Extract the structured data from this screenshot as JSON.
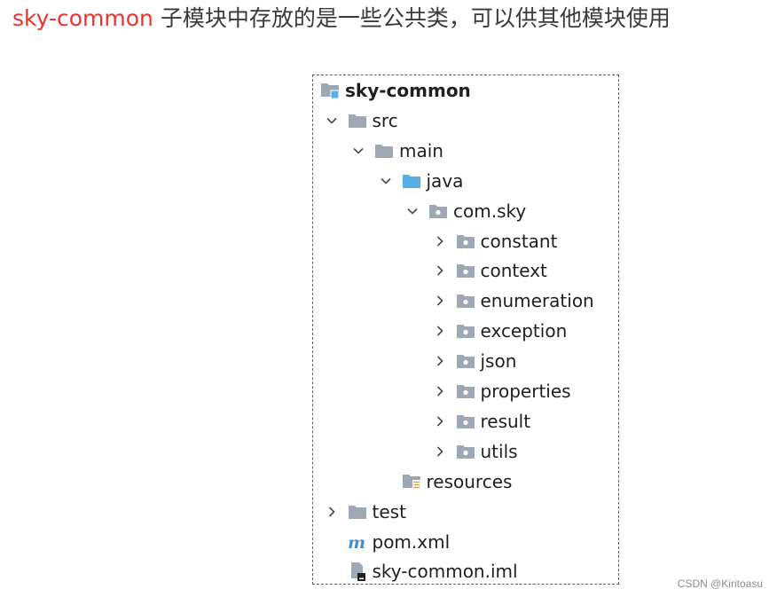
{
  "headline": {
    "accent": "sky-common",
    "rest": " 子模块中存放的是一些公共类，可以供其他模块使用"
  },
  "tree": {
    "items": [
      {
        "label": "sky-common",
        "level": 0,
        "icon": "module-folder-icon",
        "chevron": "none",
        "bold": true
      },
      {
        "label": "src",
        "level": 1,
        "icon": "folder-icon",
        "chevron": "down"
      },
      {
        "label": "main",
        "level": 2,
        "icon": "folder-icon",
        "chevron": "down"
      },
      {
        "label": "java",
        "level": 3,
        "icon": "source-root-folder-icon",
        "chevron": "down"
      },
      {
        "label": "com.sky",
        "level": 4,
        "icon": "package-icon",
        "chevron": "down"
      },
      {
        "label": "constant",
        "level": 5,
        "icon": "package-icon",
        "chevron": "right"
      },
      {
        "label": "context",
        "level": 5,
        "icon": "package-icon",
        "chevron": "right"
      },
      {
        "label": "enumeration",
        "level": 5,
        "icon": "package-icon",
        "chevron": "right"
      },
      {
        "label": "exception",
        "level": 5,
        "icon": "package-icon",
        "chevron": "right"
      },
      {
        "label": "json",
        "level": 5,
        "icon": "package-icon",
        "chevron": "right"
      },
      {
        "label": "properties",
        "level": 5,
        "icon": "package-icon",
        "chevron": "right"
      },
      {
        "label": "result",
        "level": 5,
        "icon": "package-icon",
        "chevron": "right"
      },
      {
        "label": "utils",
        "level": 5,
        "icon": "package-icon",
        "chevron": "right"
      },
      {
        "label": "resources",
        "level": 3,
        "icon": "resources-folder-icon",
        "chevron": "none"
      },
      {
        "label": "test",
        "level": 1,
        "icon": "folder-icon",
        "chevron": "right"
      },
      {
        "label": "pom.xml",
        "level": 1,
        "icon": "maven-file-icon",
        "chevron": "none"
      },
      {
        "label": "sky-common.iml",
        "level": 1,
        "icon": "iml-file-icon",
        "chevron": "none"
      }
    ]
  },
  "watermark": "CSDN @Kiritoasu",
  "colors": {
    "accent": "#e8332f",
    "folder": "#9ea7b3",
    "source_folder": "#5aaee8",
    "maven": "#3d8fd6",
    "chevron": "#4a4a4a",
    "resource_lines": "#e0a33c"
  }
}
